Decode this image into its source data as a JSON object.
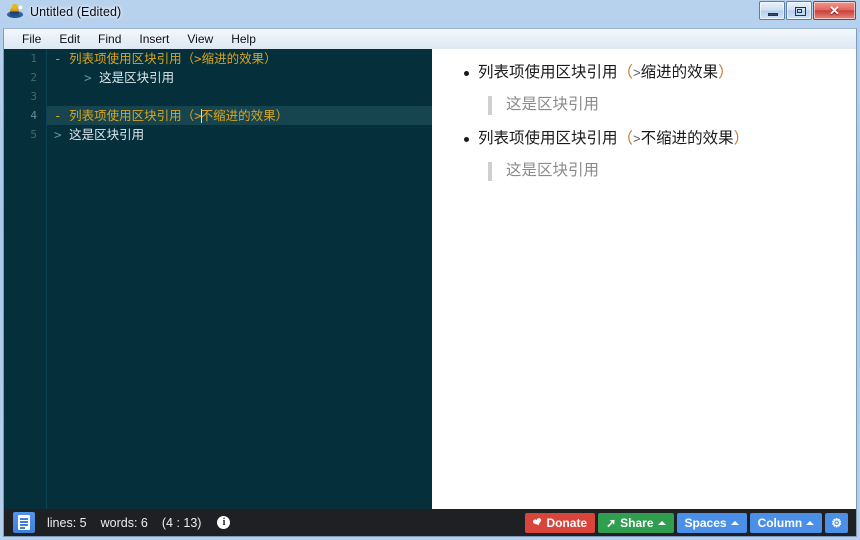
{
  "window": {
    "title": "Untitled (Edited)",
    "app_icon": "bug-icon",
    "controls": {
      "minimize": "minimize-icon",
      "maximize": "restore-icon",
      "close": "✕"
    }
  },
  "menubar": {
    "items": [
      {
        "label": "File"
      },
      {
        "label": "Edit"
      },
      {
        "label": "Find"
      },
      {
        "label": "Insert"
      },
      {
        "label": "View"
      },
      {
        "label": "Help"
      }
    ]
  },
  "editor": {
    "gutter": [
      "1",
      "2",
      "3",
      "4",
      "5"
    ],
    "active_line": 4,
    "lines": [
      {
        "number": "1",
        "marker": "- ",
        "text": "列表项使用区块引用（>缩进的效果）",
        "kind": "list"
      },
      {
        "number": "2",
        "marker": "    > ",
        "text": "这是区块引用",
        "kind": "quote"
      },
      {
        "number": "3",
        "marker": "",
        "text": "",
        "kind": "blank"
      },
      {
        "number": "4",
        "marker": "- ",
        "text_before_caret": "列表项使用区块引用（>",
        "text_after_caret": "不缩进的效果）",
        "kind": "list"
      },
      {
        "number": "5",
        "marker": "> ",
        "text": "这是区块引用",
        "kind": "quote"
      }
    ]
  },
  "preview": {
    "blocks": [
      {
        "type": "list-item",
        "text": "列表项使用区块引用",
        "paren_open": "（",
        "gt": ">",
        "paren_text": "缩进的效果",
        "paren_close": "）"
      },
      {
        "type": "blockquote",
        "text": "这是区块引用"
      },
      {
        "type": "list-item",
        "text": "列表项使用区块引用",
        "paren_open": "（",
        "gt": ">",
        "paren_text": "不缩进的效果",
        "paren_close": "）"
      },
      {
        "type": "blockquote",
        "text": "这是区块引用"
      }
    ]
  },
  "statusbar": {
    "doc_icon": "document-icon",
    "lines_label": "lines: 5",
    "words_label": "words: 6",
    "position_label": "(4 : 13)",
    "info_icon": "i",
    "buttons": [
      {
        "label": "Donate",
        "icon": "leaf-icon",
        "color": "#d9453a"
      },
      {
        "label": "Share",
        "icon": "arrow-icon",
        "color": "#2f9e4f",
        "caret": true
      },
      {
        "label": "Spaces",
        "color": "#4a90e8",
        "caret": true
      },
      {
        "label": "Column",
        "color": "#4a90e8",
        "caret": true
      },
      {
        "label": "",
        "icon": "gear-icon",
        "color": "#4a90e8"
      }
    ]
  },
  "colors": {
    "editor_bg": "#042f3b",
    "editor_active_line": "#16454f",
    "list_token": "#d9a520",
    "quote_token": "#5d9aa5",
    "preview_bg": "#ffffff",
    "statusbar_bg": "#1e2024"
  }
}
